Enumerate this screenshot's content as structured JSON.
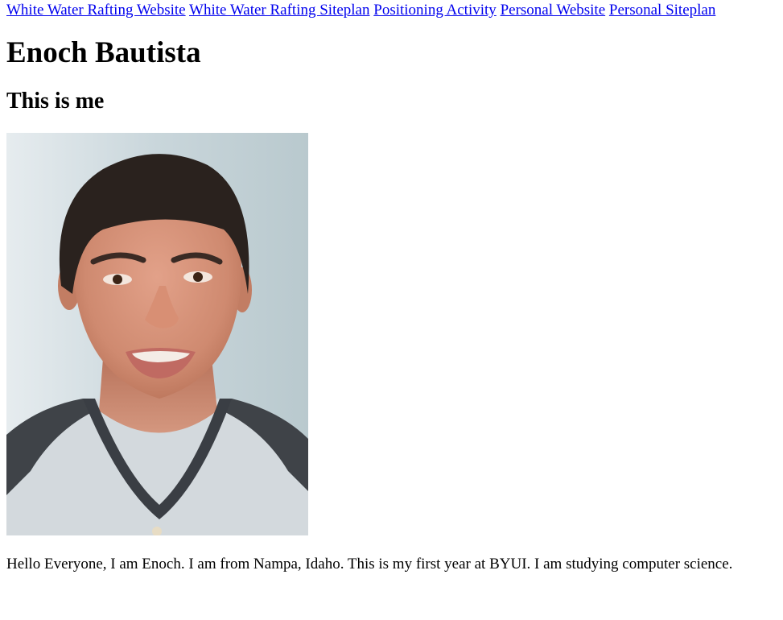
{
  "nav": {
    "links": [
      "White Water Rafting Website",
      "White Water Rafting Siteplan",
      "Positioning Activity",
      "Personal Website",
      "Personal Siteplan"
    ]
  },
  "header": {
    "title": "Enoch Bautista",
    "subtitle": "This is me"
  },
  "photo": {
    "icon": "portrait-photo"
  },
  "bio": {
    "text": "Hello Everyone, I am Enoch. I am from Nampa, Idaho. This is my first year at BYUI. I am studying computer science."
  },
  "colors": {
    "link": "#0000EE",
    "text": "#000000",
    "background": "#FFFFFF"
  }
}
